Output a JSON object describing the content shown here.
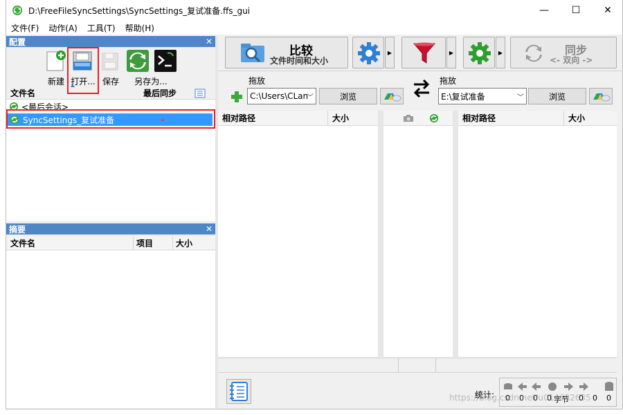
{
  "window": {
    "title": "D:\\FreeFileSyncSettings\\SyncSettings_复试准备.ffs_gui"
  },
  "window_controls": {
    "minimize": "—",
    "maximize": "☐",
    "close": "✕"
  },
  "menu": [
    "文件(F)",
    "动作(A)",
    "工具(T)",
    "帮助(H)"
  ],
  "config_panel": {
    "title": "配置",
    "close": "✕",
    "toolbar": {
      "new": "新建",
      "open": "打开...",
      "save": "保存",
      "save_as": "另存为..."
    },
    "columns": {
      "name": "文件名",
      "last_sync": "最后同步"
    },
    "items": [
      {
        "label": "<最后会话>"
      },
      {
        "label": "SyncSettings_复试准备",
        "last_sync": "–"
      }
    ]
  },
  "summary_panel": {
    "title": "摘要",
    "close": "✕",
    "columns": {
      "name": "文件名",
      "items": "项目",
      "size": "大小"
    }
  },
  "compare": {
    "title": "比较",
    "subtitle": "文件时间和大小"
  },
  "sync": {
    "title": "同步",
    "subtitle": "<- 双向 ->"
  },
  "folders": {
    "left": {
      "drop_label": "拖放",
      "path": "C:\\Users\\CLan",
      "browse": "浏览"
    },
    "right": {
      "drop_label": "拖放",
      "path": "E:\\复试准备",
      "browse": "浏览"
    }
  },
  "grid": {
    "left": {
      "col_path": "相对路径",
      "col_size": "大小"
    },
    "right": {
      "col_path": "相对路径",
      "col_size": "大小"
    }
  },
  "stats": {
    "label": "统计:",
    "values": [
      "0",
      "0",
      "0",
      "0",
      "0",
      "0",
      "0"
    ],
    "bytes_unit": "字节",
    "watermark": "https://blog.csdn.net/u014682635"
  },
  "colors": {
    "accent": "#4e86c8",
    "selection": "#3399ff",
    "highlight": "#e81f1f"
  }
}
